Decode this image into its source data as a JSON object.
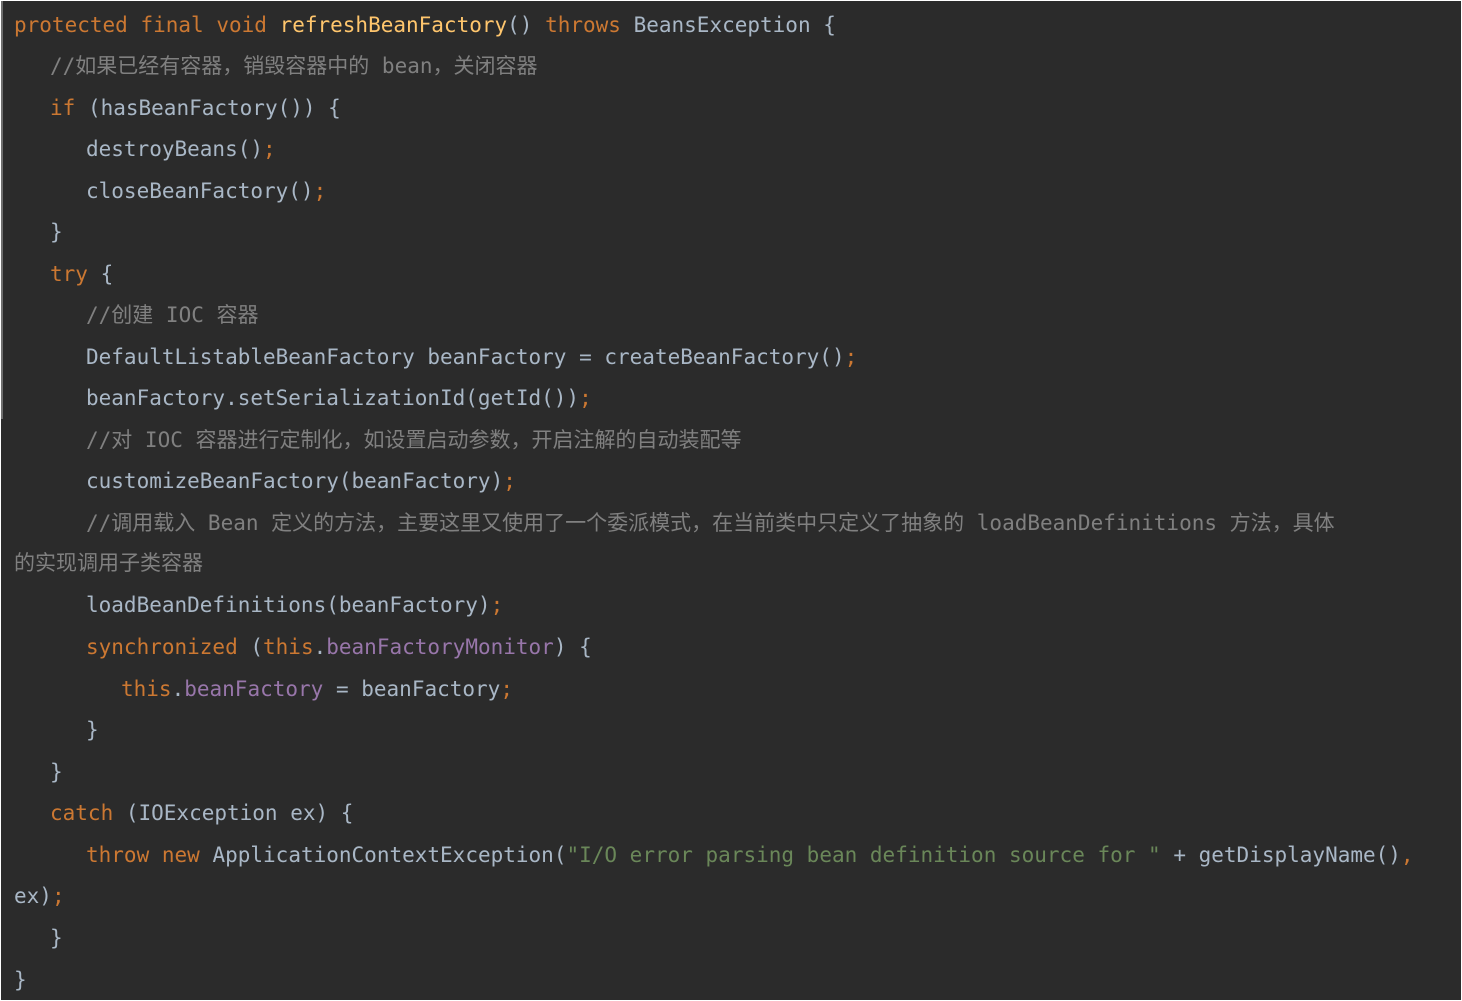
{
  "code_lines": [
    {
      "indent": 0,
      "tokens": [
        {
          "t": "protected",
          "c": "kw"
        },
        {
          "t": " "
        },
        {
          "t": "final",
          "c": "kw"
        },
        {
          "t": " "
        },
        {
          "t": "void",
          "c": "kw"
        },
        {
          "t": " "
        },
        {
          "t": "refreshBeanFactory",
          "c": "fn"
        },
        {
          "t": "() "
        },
        {
          "t": "throws",
          "c": "kw"
        },
        {
          "t": " BeansException {"
        }
      ]
    },
    {
      "indent": 1,
      "tokens": [
        {
          "t": "//如果已经有容器，销毁容器中的 bean，关闭容器",
          "c": "cm"
        }
      ]
    },
    {
      "indent": 1,
      "tokens": [
        {
          "t": "if",
          "c": "kw"
        },
        {
          "t": " (hasBeanFactory()) {"
        }
      ]
    },
    {
      "indent": 2,
      "tokens": [
        {
          "t": "destroyBeans()"
        },
        {
          "t": ";",
          "c": "semi"
        }
      ]
    },
    {
      "indent": 2,
      "tokens": [
        {
          "t": "closeBeanFactory()"
        },
        {
          "t": ";",
          "c": "semi"
        }
      ]
    },
    {
      "indent": 1,
      "tokens": [
        {
          "t": "}"
        }
      ]
    },
    {
      "indent": 1,
      "tokens": [
        {
          "t": "try",
          "c": "kw"
        },
        {
          "t": " {"
        }
      ]
    },
    {
      "indent": 2,
      "tokens": [
        {
          "t": "//创建 IOC 容器",
          "c": "cm"
        }
      ]
    },
    {
      "indent": 2,
      "tokens": [
        {
          "t": "DefaultListableBeanFactory beanFactory = createBeanFactory()"
        },
        {
          "t": ";",
          "c": "semi"
        }
      ]
    },
    {
      "indent": 2,
      "tokens": [
        {
          "t": "beanFactory.setSerializationId(getId())"
        },
        {
          "t": ";",
          "c": "semi"
        }
      ]
    },
    {
      "indent": 2,
      "tokens": [
        {
          "t": "//对 IOC 容器进行定制化，如设置启动参数，开启注解的自动装配等",
          "c": "cm"
        }
      ]
    },
    {
      "indent": 2,
      "tokens": [
        {
          "t": "customizeBeanFactory(beanFactory)"
        },
        {
          "t": ";",
          "c": "semi"
        }
      ]
    },
    {
      "indent": 2,
      "tokens": [
        {
          "t": "//调用载入 Bean 定义的方法，主要这里又使用了一个委派模式，在当前类中只定义了抽象的 loadBeanDefinitions 方法，具体",
          "c": "cm"
        }
      ]
    },
    {
      "indent": 0,
      "tokens": [
        {
          "t": "的实现调用子类容器",
          "c": "cm"
        }
      ]
    },
    {
      "indent": 2,
      "tokens": [
        {
          "t": "loadBeanDefinitions(beanFactory)"
        },
        {
          "t": ";",
          "c": "semi"
        }
      ]
    },
    {
      "indent": 2,
      "tokens": [
        {
          "t": "synchronized",
          "c": "kw"
        },
        {
          "t": " ("
        },
        {
          "t": "this",
          "c": "kw"
        },
        {
          "t": "."
        },
        {
          "t": "beanFactoryMonitor",
          "c": "fld"
        },
        {
          "t": ") {"
        }
      ]
    },
    {
      "indent": 3,
      "tokens": [
        {
          "t": "this",
          "c": "kw"
        },
        {
          "t": "."
        },
        {
          "t": "beanFactory",
          "c": "fld"
        },
        {
          "t": " = beanFactory"
        },
        {
          "t": ";",
          "c": "semi"
        }
      ]
    },
    {
      "indent": 2,
      "tokens": [
        {
          "t": "}"
        }
      ]
    },
    {
      "indent": 1,
      "tokens": [
        {
          "t": "}"
        }
      ]
    },
    {
      "indent": 1,
      "tokens": [
        {
          "t": "catch",
          "c": "kw"
        },
        {
          "t": " (IOException ex) {"
        }
      ]
    },
    {
      "indent": 2,
      "tokens": [
        {
          "t": "throw",
          "c": "kw"
        },
        {
          "t": " "
        },
        {
          "t": "new",
          "c": "kw"
        },
        {
          "t": " ApplicationContextException("
        },
        {
          "t": "\"I/O error parsing bean definition source for \"",
          "c": "str"
        },
        {
          "t": " + getDisplayName()"
        },
        {
          "t": ",",
          "c": "semi"
        }
      ]
    },
    {
      "indent": 0,
      "tokens": [
        {
          "t": "ex)"
        },
        {
          "t": ";",
          "c": "semi"
        }
      ]
    },
    {
      "indent": 1,
      "tokens": [
        {
          "t": "}"
        }
      ]
    },
    {
      "indent": 0,
      "tokens": [
        {
          "t": "}"
        }
      ]
    }
  ]
}
